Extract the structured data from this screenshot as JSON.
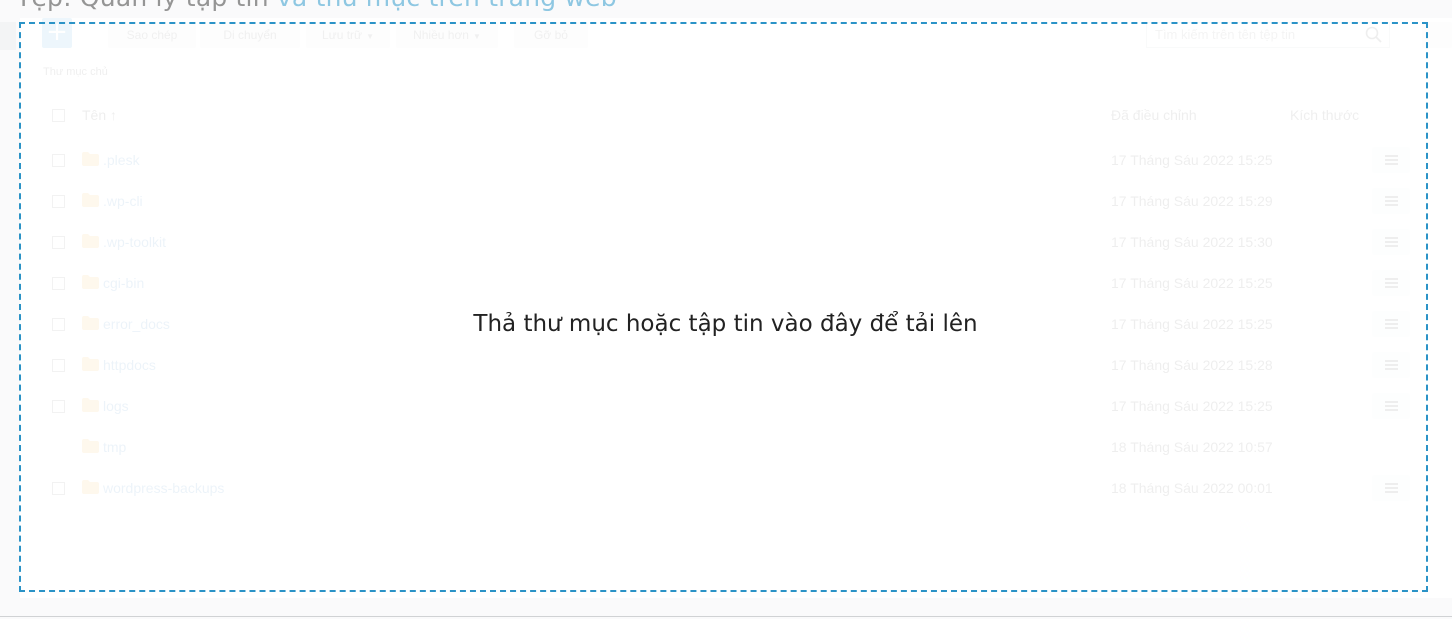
{
  "page": {
    "heading_partial": "Tệp: Quản lý tập tin",
    "heading_link_partial": "và thư mục trên trang web"
  },
  "toolbar": {
    "add_label": "+",
    "copy_label": "Sao chép",
    "move_label": "Di chuyển",
    "archive_label": "Lưu trữ",
    "more_label": "Nhiều hơn",
    "remove_label": "Gỡ bỏ",
    "search_placeholder": "Tìm kiếm trên tên tệp tin"
  },
  "breadcrumb": {
    "home": "Thư mục chủ"
  },
  "table": {
    "col_name": "Tên ↑",
    "col_modified": "Đã điều chỉnh",
    "col_size": "Kích thước",
    "rows": [
      {
        "name": ".plesk",
        "modified": "17 Tháng Sáu 2022 15:25"
      },
      {
        "name": ".wp-cli",
        "modified": "17 Tháng Sáu 2022 15:29"
      },
      {
        "name": ".wp-toolkit",
        "modified": "17 Tháng Sáu 2022 15:30"
      },
      {
        "name": "cgi-bin",
        "modified": "17 Tháng Sáu 2022 15:25"
      },
      {
        "name": "error_docs",
        "modified": "17 Tháng Sáu 2022 15:25"
      },
      {
        "name": "httpdocs",
        "modified": "17 Tháng Sáu 2022 15:28"
      },
      {
        "name": "logs",
        "modified": "17 Tháng Sáu 2022 15:25"
      },
      {
        "name": "tmp",
        "modified": "18 Tháng Sáu 2022 10:57"
      },
      {
        "name": "wordpress-backups",
        "modified": "18 Tháng Sáu 2022 00:01"
      }
    ]
  },
  "overlay": {
    "drop_message": "Thả thư mục hoặc tập tin vào đây để tải lên"
  },
  "colors": {
    "accent": "#2b93c7",
    "folder": "#f5a623",
    "link": "#1c70b8"
  }
}
